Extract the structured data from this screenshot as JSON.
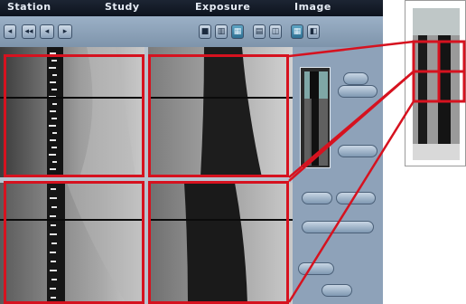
{
  "titlebar": {
    "items": [
      "Station",
      "Study",
      "Exposure",
      "Image"
    ]
  },
  "toolbar": {
    "left_buttons": [
      "◂",
      "◂◂",
      "◂",
      "▸"
    ],
    "layout_buttons": [
      "1x1",
      "1x2",
      "2x2",
      "2x1",
      "fit",
      "grid",
      "sync"
    ]
  },
  "viewer": {
    "tiles": [
      "upper-left",
      "upper-right",
      "lower-left",
      "lower-right"
    ]
  },
  "panel": {
    "buttons": [
      "",
      "",
      "",
      "",
      "",
      "",
      "",
      ""
    ]
  },
  "colors": {
    "highlight": "#d6121f",
    "panel_bg": "#8ea2b9",
    "titlebar_bg": "#0d131d"
  }
}
